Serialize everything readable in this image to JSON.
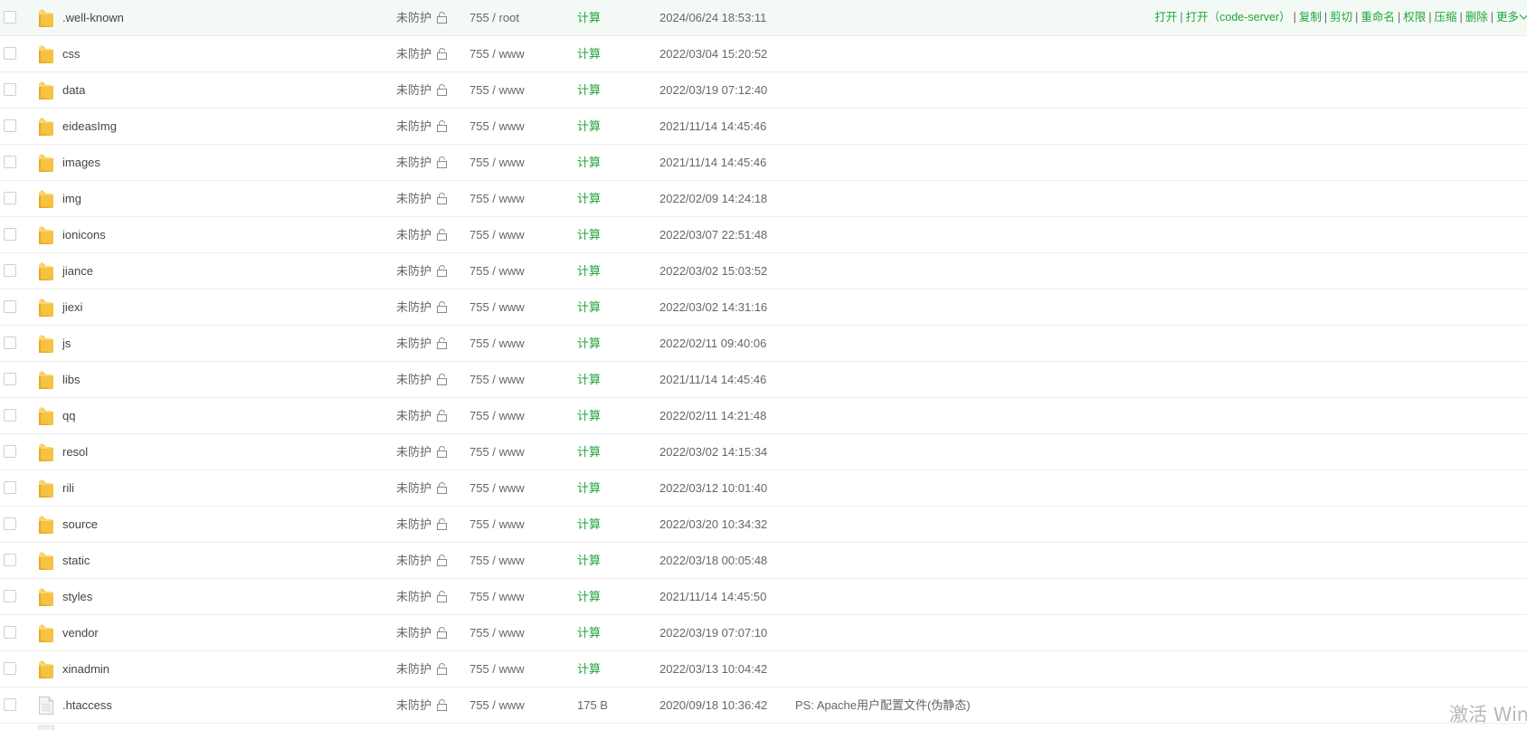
{
  "colors": {
    "accent": "#20a53a",
    "text": "#555555",
    "folder": "#f5c242",
    "row_hover": "#f3faf6",
    "divider": "#ececec"
  },
  "rows": [
    {
      "name": ".well-known",
      "type": "folder",
      "protect": "未防护",
      "perm": "755 / root",
      "size": "计算",
      "size_is_link": true,
      "mtime": "2024/06/24 18:53:11",
      "remark": ""
    },
    {
      "name": "css",
      "type": "folder",
      "protect": "未防护",
      "perm": "755 / www",
      "size": "计算",
      "size_is_link": true,
      "mtime": "2022/03/04 15:20:52",
      "remark": ""
    },
    {
      "name": "data",
      "type": "folder",
      "protect": "未防护",
      "perm": "755 / www",
      "size": "计算",
      "size_is_link": true,
      "mtime": "2022/03/19 07:12:40",
      "remark": ""
    },
    {
      "name": "eideasImg",
      "type": "folder",
      "protect": "未防护",
      "perm": "755 / www",
      "size": "计算",
      "size_is_link": true,
      "mtime": "2021/11/14 14:45:46",
      "remark": ""
    },
    {
      "name": "images",
      "type": "folder",
      "protect": "未防护",
      "perm": "755 / www",
      "size": "计算",
      "size_is_link": true,
      "mtime": "2021/11/14 14:45:46",
      "remark": ""
    },
    {
      "name": "img",
      "type": "folder",
      "protect": "未防护",
      "perm": "755 / www",
      "size": "计算",
      "size_is_link": true,
      "mtime": "2022/02/09 14:24:18",
      "remark": ""
    },
    {
      "name": "ionicons",
      "type": "folder",
      "protect": "未防护",
      "perm": "755 / www",
      "size": "计算",
      "size_is_link": true,
      "mtime": "2022/03/07 22:51:48",
      "remark": ""
    },
    {
      "name": "jiance",
      "type": "folder",
      "protect": "未防护",
      "perm": "755 / www",
      "size": "计算",
      "size_is_link": true,
      "mtime": "2022/03/02 15:03:52",
      "remark": ""
    },
    {
      "name": "jiexi",
      "type": "folder",
      "protect": "未防护",
      "perm": "755 / www",
      "size": "计算",
      "size_is_link": true,
      "mtime": "2022/03/02 14:31:16",
      "remark": ""
    },
    {
      "name": "js",
      "type": "folder",
      "protect": "未防护",
      "perm": "755 / www",
      "size": "计算",
      "size_is_link": true,
      "mtime": "2022/02/11 09:40:06",
      "remark": ""
    },
    {
      "name": "libs",
      "type": "folder",
      "protect": "未防护",
      "perm": "755 / www",
      "size": "计算",
      "size_is_link": true,
      "mtime": "2021/11/14 14:45:46",
      "remark": ""
    },
    {
      "name": "qq",
      "type": "folder",
      "protect": "未防护",
      "perm": "755 / www",
      "size": "计算",
      "size_is_link": true,
      "mtime": "2022/02/11 14:21:48",
      "remark": ""
    },
    {
      "name": "resol",
      "type": "folder",
      "protect": "未防护",
      "perm": "755 / www",
      "size": "计算",
      "size_is_link": true,
      "mtime": "2022/03/02 14:15:34",
      "remark": ""
    },
    {
      "name": "rili",
      "type": "folder",
      "protect": "未防护",
      "perm": "755 / www",
      "size": "计算",
      "size_is_link": true,
      "mtime": "2022/03/12 10:01:40",
      "remark": ""
    },
    {
      "name": "source",
      "type": "folder",
      "protect": "未防护",
      "perm": "755 / www",
      "size": "计算",
      "size_is_link": true,
      "mtime": "2022/03/20 10:34:32",
      "remark": ""
    },
    {
      "name": "static",
      "type": "folder",
      "protect": "未防护",
      "perm": "755 / www",
      "size": "计算",
      "size_is_link": true,
      "mtime": "2022/03/18 00:05:48",
      "remark": ""
    },
    {
      "name": "styles",
      "type": "folder",
      "protect": "未防护",
      "perm": "755 / www",
      "size": "计算",
      "size_is_link": true,
      "mtime": "2021/11/14 14:45:50",
      "remark": ""
    },
    {
      "name": "vendor",
      "type": "folder",
      "protect": "未防护",
      "perm": "755 / www",
      "size": "计算",
      "size_is_link": true,
      "mtime": "2022/03/19 07:07:10",
      "remark": ""
    },
    {
      "name": "xinadmin",
      "type": "folder",
      "protect": "未防护",
      "perm": "755 / www",
      "size": "计算",
      "size_is_link": true,
      "mtime": "2022/03/13 10:04:42",
      "remark": ""
    },
    {
      "name": ".htaccess",
      "type": "file",
      "protect": "未防护",
      "perm": "755 / www",
      "size": "175 B",
      "size_is_link": false,
      "mtime": "2020/09/18 10:36:42",
      "remark": "PS: Apache用户配置文件(伪静态)"
    }
  ],
  "row_actions": {
    "open": "打开",
    "open_code_server": "打开（code-server）",
    "copy": "复制",
    "cut": "剪切",
    "rename": "重命名",
    "permission": "权限",
    "compress": "压缩",
    "delete": "删除",
    "more": "更多"
  },
  "icons": {
    "folder": "folder-icon",
    "file": "file-icon",
    "lock": "lock-open-icon",
    "checkbox": "checkbox"
  },
  "watermark": {
    "text": "激活 Win"
  }
}
